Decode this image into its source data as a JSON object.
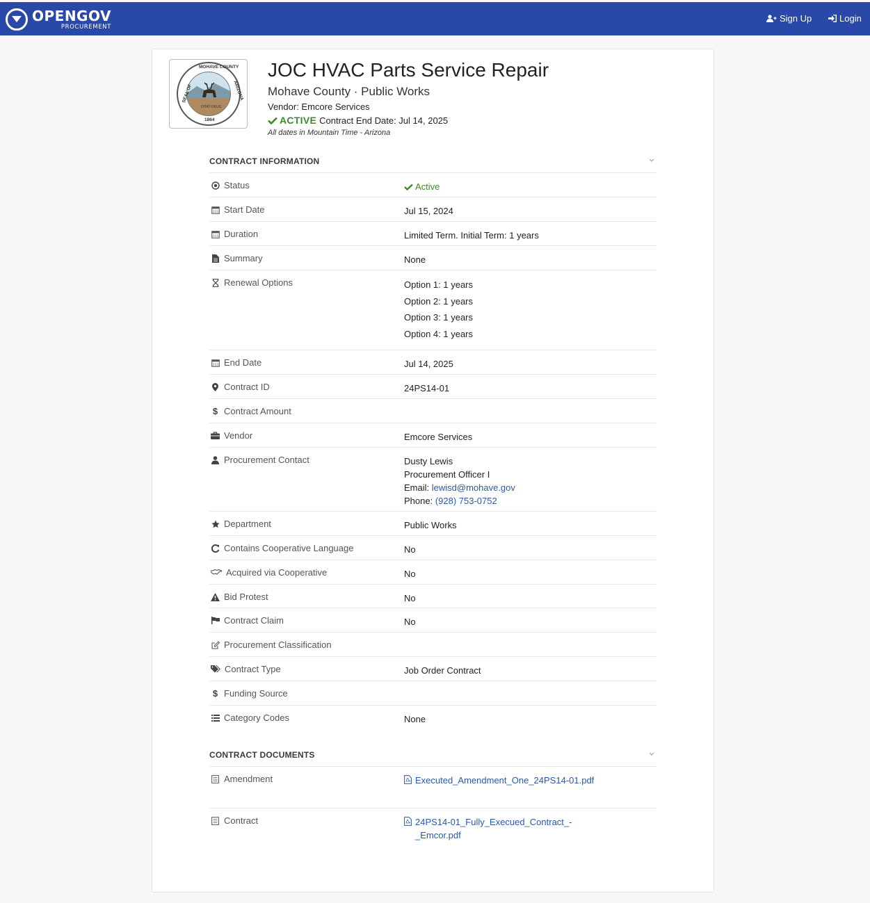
{
  "nav": {
    "brand_name": "OPENGOV",
    "brand_sub": "PROCUREMENT",
    "signup_label": "Sign Up",
    "login_label": "Login"
  },
  "header": {
    "seal_text_top": "MOHAVE COUNTY",
    "seal_text_left": "SEAL OF",
    "seal_text_right": "ARIZONA",
    "seal_motto": "DITAT DEUS",
    "seal_year": "1864",
    "title": "JOC HVAC Parts Service Repair",
    "subtitle": "Mohave County · Public Works",
    "vendor": "Vendor: Emcore Services",
    "status": "ACTIVE",
    "end_date_text": "Contract End Date: Jul 14, 2025",
    "timezone_note": "All dates in Mountain Time - Arizona"
  },
  "contract_info": {
    "heading": "CONTRACT INFORMATION",
    "rows": [
      {
        "label": "Status",
        "icon": "dot-circle-icon",
        "value": "Active"
      },
      {
        "label": "Start Date",
        "icon": "calendar-icon",
        "value": "Jul 15, 2024"
      },
      {
        "label": "Duration",
        "icon": "calendar-icon",
        "value": "Limited Term. Initial Term: 1 years"
      },
      {
        "label": "Summary",
        "icon": "file-icon",
        "value": "None"
      },
      {
        "label": "Renewal Options",
        "icon": "hourglass-icon",
        "values": [
          "Option 1: 1 years",
          "Option 2: 1 years",
          "Option 3: 1 years",
          "Option 4: 1 years"
        ]
      },
      {
        "label": "End Date",
        "icon": "calendar-icon",
        "value": "Jul 14, 2025"
      },
      {
        "label": "Contract ID",
        "icon": "map-marker-icon",
        "value": "24PS14-01"
      },
      {
        "label": "Contract Amount",
        "icon": "dollar-icon",
        "value": ""
      },
      {
        "label": "Vendor",
        "icon": "briefcase-icon",
        "value": "Emcore Services"
      },
      {
        "label": "Procurement Contact",
        "icon": "user-icon",
        "contact": {
          "name": "Dusty Lewis",
          "title": "Procurement Officer I",
          "email_label": "Email:",
          "email": "lewisd@mohave.gov",
          "phone_label": "Phone:",
          "phone": "(928) 753-0752"
        }
      },
      {
        "label": "Department",
        "icon": "star-icon",
        "value": "Public Works"
      },
      {
        "label": "Contains Cooperative Language",
        "icon": "refresh-icon",
        "value": "No"
      },
      {
        "label": "Acquired via Cooperative",
        "icon": "handshake-icon",
        "value": "No"
      },
      {
        "label": "Bid Protest",
        "icon": "warning-icon",
        "value": "No"
      },
      {
        "label": "Contract Claim",
        "icon": "flag-icon",
        "value": "No"
      },
      {
        "label": "Procurement Classification",
        "icon": "edit-icon",
        "value": ""
      },
      {
        "label": "Contract Type",
        "icon": "tags-icon",
        "value": "Job Order Contract"
      },
      {
        "label": "Funding Source",
        "icon": "dollar-icon",
        "value": ""
      },
      {
        "label": "Category Codes",
        "icon": "list-icon",
        "value": "None"
      }
    ]
  },
  "documents": {
    "heading": "CONTRACT DOCUMENTS",
    "rows": [
      {
        "label": "Amendment",
        "icon": "file-text-icon",
        "file": "Executed_Amendment_One_24PS14-01.pdf"
      },
      {
        "label": "Contract",
        "icon": "file-text-icon",
        "file": "24PS14-01_Fully_Execued_Contract_-_Emcor.pdf"
      }
    ]
  },
  "colors": {
    "navbar": "#2a48a8",
    "active_green": "#3c8a2a",
    "link": "#2a57a8"
  }
}
